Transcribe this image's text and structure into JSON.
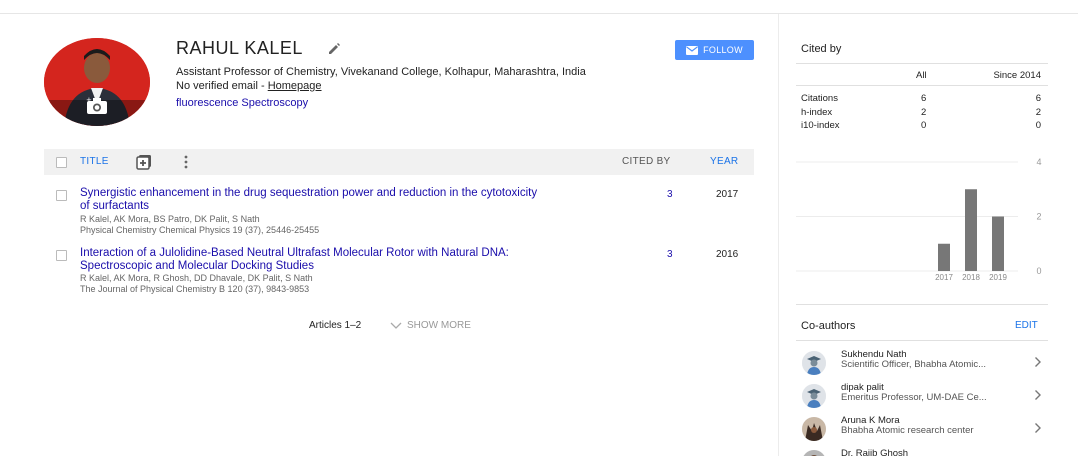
{
  "profile": {
    "name": "RAHUL KALEL",
    "affiliation": "Assistant Professor of Chemistry, Vivekanand College, Kolhapur, Maharashtra, India",
    "email_status": "No verified email - ",
    "homepage_label": "Homepage",
    "interest": "fluorescence Spectroscopy",
    "follow_label": "FOLLOW"
  },
  "table": {
    "title_col": "TITLE",
    "cited_by_col": "CITED BY",
    "year_col": "YEAR",
    "rows": [
      {
        "title_line1": "Synergistic enhancement in the drug sequestration power and reduction in the cytotoxicity",
        "title_line2": "of surfactants",
        "authors": "R Kalel, AK Mora, BS Patro, DK Palit, S Nath",
        "venue": "Physical Chemistry Chemical Physics 19 (37), 25446-25455",
        "cited": "3",
        "year": "2017"
      },
      {
        "title_line1": "Interaction of a Julolidine-Based Neutral Ultrafast Molecular Rotor with Natural DNA:",
        "title_line2": "Spectroscopic and Molecular Docking Studies",
        "authors": "R Kalel, AK Mora, R Ghosh, DD Dhavale, DK Palit, S Nath",
        "venue": "The Journal of Physical Chemistry B 120 (37), 9843-9853",
        "cited": "3",
        "year": "2016"
      }
    ],
    "articles_count": "Articles 1–2",
    "show_more": "SHOW MORE"
  },
  "cited_by": {
    "title": "Cited by",
    "col_all": "All",
    "col_since": "Since 2014",
    "rows": [
      {
        "label": "Citations",
        "all": "6",
        "since": "6"
      },
      {
        "label": "h-index",
        "all": "2",
        "since": "2"
      },
      {
        "label": "i10-index",
        "all": "0",
        "since": "0"
      }
    ]
  },
  "chart_data": {
    "type": "bar",
    "categories": [
      "2017",
      "2018",
      "2019"
    ],
    "values": [
      1,
      3,
      2
    ],
    "ylim": [
      0,
      4
    ],
    "yticks": [
      "0",
      "2",
      "4"
    ],
    "grid": true
  },
  "coauthors": {
    "title": "Co-authors",
    "edit_label": "EDIT",
    "items": [
      {
        "name": "Sukhendu Nath",
        "affiliation": "Scientific Officer, Bhabha Atomic...",
        "avatar": "generic"
      },
      {
        "name": "dipak palit",
        "affiliation": "Emeritus Professor, UM-DAE Ce...",
        "avatar": "generic"
      },
      {
        "name": "Aruna K Mora",
        "affiliation": "Bhabha Atomic research center",
        "avatar": "photo"
      },
      {
        "name": "Dr. Rajib Ghosh",
        "affiliation": "",
        "avatar": "photo"
      }
    ]
  },
  "colors": {
    "link": "#1a0dab",
    "accent": "#1a73e8",
    "follow_button": "#4d90fe",
    "avatar_bg": "#d4251e",
    "bar": "#777777"
  }
}
